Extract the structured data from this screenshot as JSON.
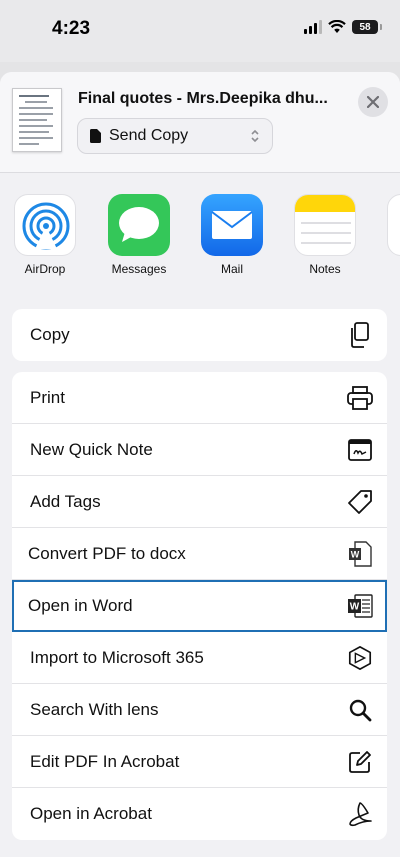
{
  "status_bar": {
    "time": "4:23",
    "battery": "58"
  },
  "header": {
    "title": "Final quotes - Mrs.Deepika dhu...",
    "send_copy_label": "Send Copy"
  },
  "apps": [
    {
      "label": "AirDrop",
      "icon": "airdrop-icon"
    },
    {
      "label": "Messages",
      "icon": "messages-icon"
    },
    {
      "label": "Mail",
      "icon": "mail-icon"
    },
    {
      "label": "Notes",
      "icon": "notes-icon"
    }
  ],
  "actions_group1": [
    {
      "label": "Copy",
      "icon": "copy-icon"
    }
  ],
  "actions_group2": [
    {
      "label": "Print",
      "icon": "printer-icon"
    },
    {
      "label": "New Quick Note",
      "icon": "quick-note-icon"
    },
    {
      "label": "Add Tags",
      "icon": "tag-icon"
    },
    {
      "label": "Convert PDF to docx",
      "icon": "word-doc-icon"
    },
    {
      "label": "Open in Word",
      "icon": "word-icon"
    },
    {
      "label": "Import to Microsoft 365",
      "icon": "microsoft-365-icon"
    },
    {
      "label": "Search With lens",
      "icon": "search-icon"
    },
    {
      "label": "Edit PDF In Acrobat",
      "icon": "edit-icon"
    },
    {
      "label": "Open in Acrobat",
      "icon": "acrobat-icon"
    }
  ],
  "colors": {
    "highlight": "#1f6fb4",
    "airdrop": "#1e88e5",
    "messages": "#34c759",
    "mail": "#1a8cff",
    "notes": "#ffd60a"
  }
}
